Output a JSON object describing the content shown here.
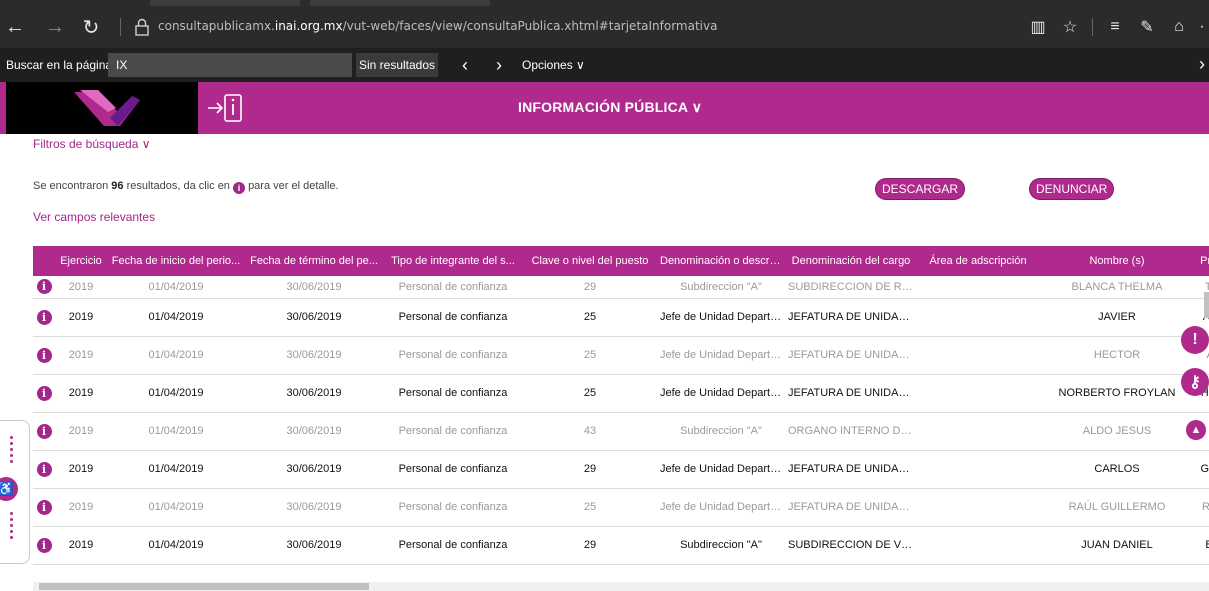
{
  "browser": {
    "url_prefix": "consultapublicamx.",
    "url_domain": "inai.org.mx",
    "url_path": "/vut-web/faces/view/consultaPublica.xhtml#tarjetaInformativa"
  },
  "find_bar": {
    "label": "Buscar en la página",
    "query": "IX",
    "result": "Sin resultados",
    "options": "Opciones ∨"
  },
  "header": {
    "title": "INFORMACIÓN PÚBLICA ∨"
  },
  "filters_label": "Filtros de búsqueda ∨",
  "summary": {
    "prefix": "Se encontraron",
    "count": "96",
    "middle": "resultados, da clic en",
    "suffix": "para ver el detalle."
  },
  "fields_link": "Ver campos relevantes",
  "buttons": {
    "download": "DESCARGAR",
    "report": "DENUNCIAR"
  },
  "table": {
    "columns": [
      "",
      "Ejercicio",
      "Fecha de inicio del perio...",
      "Fecha de término del pe...",
      "Tipo de integrante del s...",
      "Clave o nivel del puesto",
      "Denominación o descrip...",
      "Denominación del cargo",
      "Área de adscripción",
      "Nombre (s)",
      "Primer ap"
    ],
    "rows": [
      {
        "style": "dim",
        "cells": [
          "2019",
          "01/04/2019",
          "30/06/2019",
          "Personal de confianza",
          "29",
          "Subdireccion \"A\"",
          "SUBDIRECCION DE REC...",
          "",
          "BLANCA THELMA",
          "TORRE"
        ]
      },
      {
        "style": "bold",
        "cells": [
          "2019",
          "01/04/2019",
          "30/06/2019",
          "Personal de confianza",
          "25",
          "Jefe de Unidad Departament...",
          "JEFATURA DE UNIDAD...",
          "",
          "JAVIER",
          "ARELLA"
        ]
      },
      {
        "style": "dim",
        "cells": [
          "2019",
          "01/04/2019",
          "30/06/2019",
          "Personal de confianza",
          "25",
          "Jefe de Unidad Departament...",
          "JEFATURA DE UNIDAD...",
          "",
          "HECTOR",
          "ARGUI"
        ]
      },
      {
        "style": "bold",
        "cells": [
          "2019",
          "01/04/2019",
          "30/06/2019",
          "Personal de confianza",
          "25",
          "Jefe de Unidad Departament...",
          "JEFATURA DE UNIDAD...",
          "",
          "NORBERTO FROYLAN",
          "HERRAN"
        ]
      },
      {
        "style": "dim",
        "cells": [
          "2019",
          "01/04/2019",
          "30/06/2019",
          "Personal de confianza",
          "43",
          "Subdireccion \"A\"",
          "ORGANO INTERNO DE...",
          "",
          "ALDO JESUS",
          "LECO"
        ]
      },
      {
        "style": "bold",
        "cells": [
          "2019",
          "01/04/2019",
          "30/06/2019",
          "Personal de confianza",
          "29",
          "Jefe de Unidad Departament...",
          "JEFATURA DE UNIDAD...",
          "",
          "CARLOS",
          "GUERRE"
        ]
      },
      {
        "style": "dim",
        "cells": [
          "2019",
          "01/04/2019",
          "30/06/2019",
          "Personal de confianza",
          "25",
          "Jefe de Unidad Departament...",
          "JEFATURA DE UNIDAD...",
          "",
          "RAÚL GUILLERMO",
          "RODRÍG"
        ]
      },
      {
        "style": "bold",
        "cells": [
          "2019",
          "01/04/2019",
          "30/06/2019",
          "Personal de confianza",
          "29",
          "Subdireccion \"A\"",
          "SUBDIRECCION DE VER...",
          "",
          "JUAN DANIEL",
          "BEDOL"
        ]
      }
    ]
  },
  "colors": {
    "brand": "#b02a8d",
    "link": "#a3278a"
  }
}
